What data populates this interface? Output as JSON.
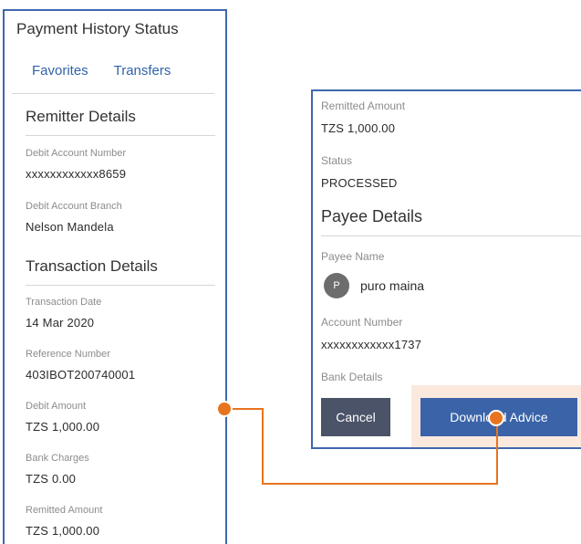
{
  "left_screen": {
    "title": "Payment History Status",
    "tabs": [
      {
        "label": "Favorites"
      },
      {
        "label": "Transfers"
      }
    ],
    "remitter": {
      "heading": "Remitter Details",
      "debit_account_number": {
        "label": "Debit Account Number",
        "value": "xxxxxxxxxxxx8659"
      },
      "debit_account_branch": {
        "label": "Debit Account Branch",
        "value": "Nelson Mandela"
      }
    },
    "transaction": {
      "heading": "Transaction Details",
      "transaction_date": {
        "label": "Transaction Date",
        "value": "14 Mar 2020"
      },
      "reference_number": {
        "label": "Reference Number",
        "value": "403IBOT200740001"
      },
      "debit_amount": {
        "label": "Debit Amount",
        "value": "TZS 1,000.00"
      },
      "bank_charges": {
        "label": "Bank Charges",
        "value": "TZS 0.00"
      },
      "remitted_amount": {
        "label": "Remitted Amount",
        "value": "TZS 1,000.00"
      }
    }
  },
  "right_screen": {
    "remitted_amount": {
      "label": "Remitted Amount",
      "value": "TZS 1,000.00"
    },
    "status": {
      "label": "Status",
      "value": "PROCESSED"
    },
    "payee": {
      "heading": "Payee Details",
      "payee_name_label": "Payee Name",
      "avatar_initial": "P",
      "payee_name": "puro maina",
      "account_number": {
        "label": "Account Number",
        "value": "xxxxxxxxxxxx1737"
      },
      "bank_details_label": "Bank Details"
    },
    "buttons": {
      "cancel": "Cancel",
      "download_advice": "Download Advice"
    }
  },
  "colors": {
    "frame_border": "#3f67ad",
    "tab_text": "#2f64a8",
    "cancel_button": "#4a5368",
    "download_button": "#3a63a8",
    "callout": "#e8741f",
    "highlight": "#fbe9de"
  }
}
